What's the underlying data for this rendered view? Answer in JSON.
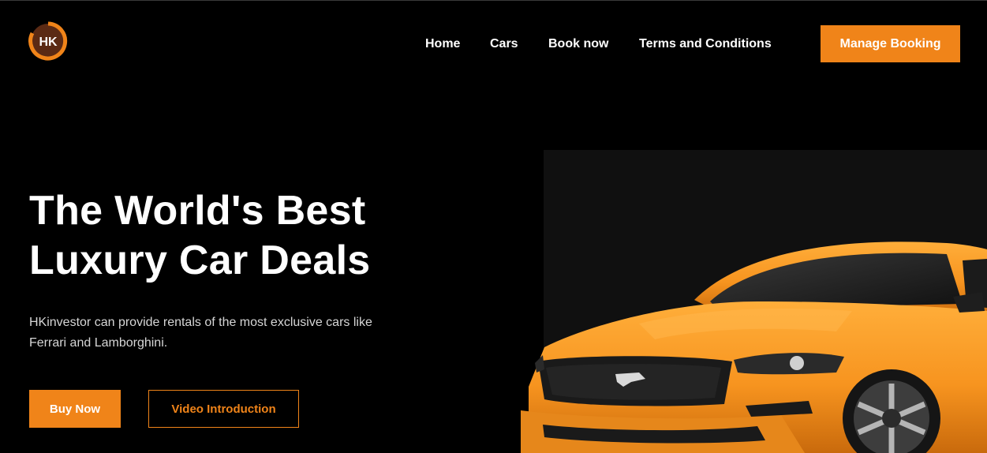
{
  "brand": {
    "logo_text": "HK",
    "accent_color": "#f08419"
  },
  "nav": {
    "items": [
      {
        "label": "Home"
      },
      {
        "label": "Cars"
      },
      {
        "label": "Book now"
      },
      {
        "label": "Terms and Conditions"
      }
    ],
    "cta_label": "Manage Booking"
  },
  "hero": {
    "title_line1": "The World's Best",
    "title_line2": "Luxury Car Deals",
    "description": "HKinvestor can provide rentals of the most exclusive cars like Ferrari and Lamborghini.",
    "primary_button": "Buy Now",
    "secondary_button": "Video Introduction",
    "image": "orange-sports-car"
  }
}
